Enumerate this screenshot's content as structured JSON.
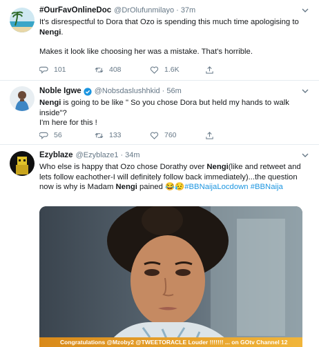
{
  "tweets": [
    {
      "name": "#OurFavOnlineDoc",
      "handle": "@DrOlufunmilayo",
      "time": "37m",
      "line1_pre": "It's disrespectful to Dora that Ozo is spending this much time apologising to",
      "line1_hl": "Nengi",
      "line1_post": ".",
      "line2": "Makes it look like choosing her was a mistake. That's horrible.",
      "replies": "101",
      "retweets": "408",
      "likes": "1.6K"
    },
    {
      "name": "Noble Igwe",
      "handle": "@Nobsdaslushhkid",
      "time": "56m",
      "line1_hl": "Nengi",
      "line1_post": " is going to be like \" So you chose Dora but held my hands to walk inside\"?",
      "line2": "I'm here for this !",
      "replies": "56",
      "retweets": "133",
      "likes": "760"
    },
    {
      "name": "Ezyblaze",
      "handle": "@Ezyblaze1",
      "time": "34m",
      "part1": "Who else is happy that Ozo chose Dorathy over ",
      "hl1": "Nengi",
      "part2": "(like and retweet and lets follow eachother-I will definitely follow back immediately)...the question now is why is Madam ",
      "hl2": "Nengi",
      "part3": " pained ",
      "emoji": "😂😥",
      "tag1": "#BBNaijaLocdown",
      "tag2": "#BBNaija",
      "banner": "Congratulations @Mzoby2 @TWEETORACLE Louder !!!!!!! ... on GOtv Channel 12"
    }
  ],
  "colors": {
    "accent": "#1b95e0",
    "muted": "#657786",
    "text": "#14171a",
    "divider": "#e6ecf0"
  }
}
